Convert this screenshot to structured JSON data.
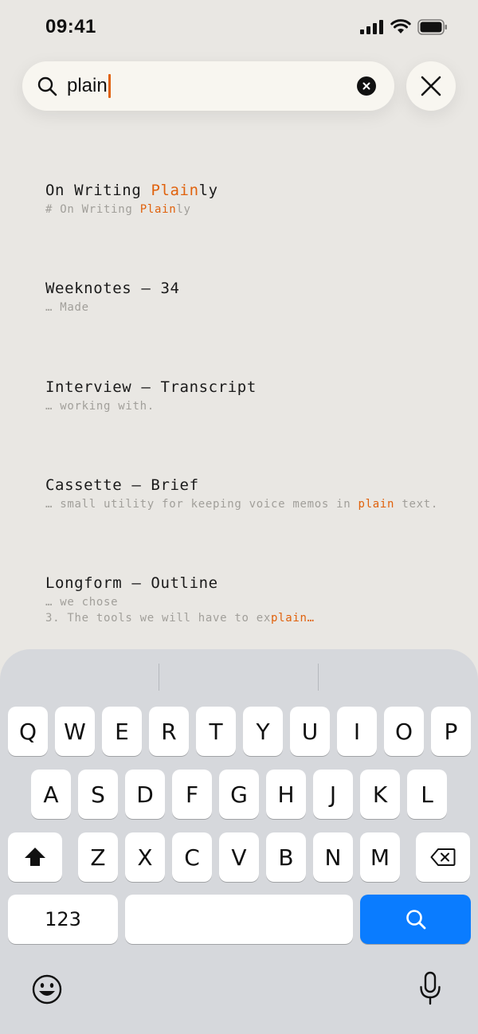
{
  "status": {
    "time": "09:41"
  },
  "search": {
    "query": "plain"
  },
  "results": [
    {
      "title_pre": "On Writing ",
      "title_hl": "Plain",
      "title_post": "ly",
      "snippet_pre": "# On Writing ",
      "snippet_hl": "Plain",
      "snippet_post": "ly"
    },
    {
      "title": "Weeknotes — 34",
      "snippet": "… Made"
    },
    {
      "title": "Interview — Transcript",
      "snippet": "… working with."
    },
    {
      "title": "Cassette — Brief",
      "snippet_pre": "… small utility for keeping voice memos in ",
      "snippet_hl": "plain",
      "snippet_post": " text."
    },
    {
      "title": "Longform — Outline",
      "snippet": "… we chose",
      "snippet2_pre": "3. The tools we will have to ex",
      "snippet2_hl": "plain…"
    }
  ],
  "keyboard": {
    "row1": [
      "Q",
      "W",
      "E",
      "R",
      "T",
      "Y",
      "U",
      "I",
      "O",
      "P"
    ],
    "row2": [
      "A",
      "S",
      "D",
      "F",
      "G",
      "H",
      "J",
      "K",
      "L"
    ],
    "row3": [
      "Z",
      "X",
      "C",
      "V",
      "B",
      "N",
      "M"
    ],
    "numbers_label": "123",
    "icons": {
      "shift": "shift-icon",
      "delete": "delete-icon",
      "search": "search-icon",
      "emoji": "emoji-icon",
      "mic": "microphone-icon"
    }
  },
  "colors": {
    "accent": "#e0620d",
    "search_key": "#0a7cff",
    "background": "#e9e7e3"
  }
}
